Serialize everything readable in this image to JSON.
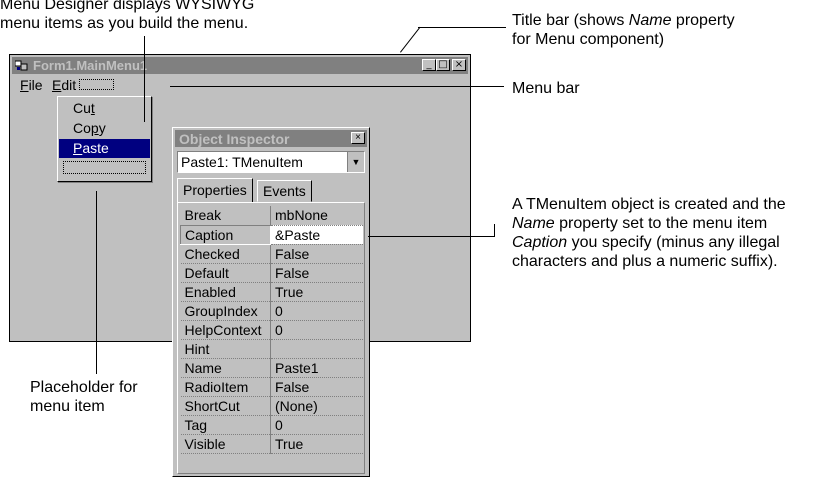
{
  "callouts": {
    "menu_designer_1": "Menu Designer displays WYSIWYG",
    "menu_designer_2": "menu items as you build the menu.",
    "title_bar_1_pre": "Title bar (shows ",
    "title_bar_1_em": "Name",
    "title_bar_1_post": " property",
    "title_bar_2": "for Menu component)",
    "menu_bar": "Menu bar",
    "tmenuitem_1": "A TMenuItem object is created and the",
    "tmenuitem_2_em": "Name",
    "tmenuitem_2_post": " property set to the menu item",
    "tmenuitem_3_em": "Caption",
    "tmenuitem_3_post": " you specify (minus any illegal",
    "tmenuitem_4": "characters and plus a numeric suffix).",
    "placeholder_1": "Placeholder for",
    "placeholder_2": "menu item"
  },
  "form": {
    "title": "Form1.MainMenu1",
    "controls": {
      "minimize": "_",
      "maximize": "□",
      "close": "×"
    },
    "menu": {
      "file_mnemonic": "F",
      "file_rest": "ile",
      "edit_mnemonic": "E",
      "edit_rest": "dit"
    }
  },
  "edit_menu": {
    "items": [
      {
        "pre": "Cu",
        "mnemonic": "t",
        "post": ""
      },
      {
        "pre": "Co",
        "mnemonic": "p",
        "post": "y"
      },
      {
        "pre": "",
        "mnemonic": "P",
        "post": "aste"
      }
    ],
    "selected_index": 2
  },
  "object_inspector": {
    "title": "Object Inspector",
    "close": "×",
    "selected_object": "Paste1: TMenuItem",
    "tabs": [
      "Properties",
      "Events"
    ],
    "active_tab": "Properties",
    "properties": [
      {
        "name": "Break",
        "value": "mbNone"
      },
      {
        "name": "Caption",
        "value": "&Paste"
      },
      {
        "name": "Checked",
        "value": "False"
      },
      {
        "name": "Default",
        "value": "False"
      },
      {
        "name": "Enabled",
        "value": "True"
      },
      {
        "name": "GroupIndex",
        "value": "0"
      },
      {
        "name": "HelpContext",
        "value": "0"
      },
      {
        "name": "Hint",
        "value": ""
      },
      {
        "name": "Name",
        "value": "Paste1"
      },
      {
        "name": "RadioItem",
        "value": "False"
      },
      {
        "name": "ShortCut",
        "value": "(None)"
      },
      {
        "name": "Tag",
        "value": "0"
      },
      {
        "name": "Visible",
        "value": "True"
      }
    ],
    "active_property": "Caption"
  },
  "colors": {
    "window_face": "#c0c0c0",
    "inactive_title": "#808080",
    "selection": "#000080"
  }
}
